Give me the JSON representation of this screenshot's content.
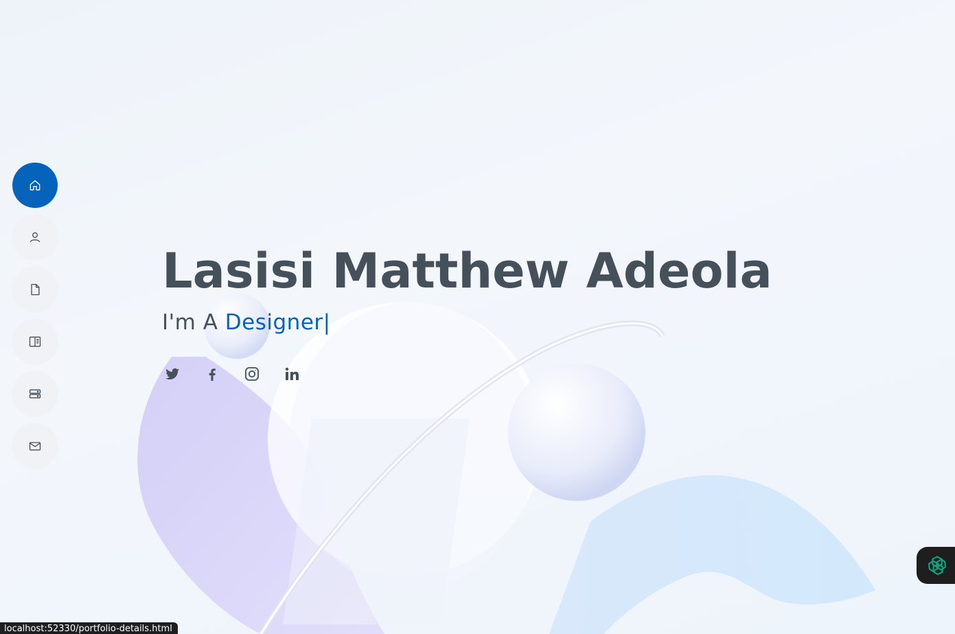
{
  "hero": {
    "name": "Lasisi Matthew Adeola",
    "subtitle_prefix": "I'm A",
    "subtitle_typed": "Designer|"
  },
  "nav": {
    "items": [
      {
        "icon": "home-icon",
        "active": true
      },
      {
        "icon": "person-icon",
        "active": false
      },
      {
        "icon": "file-icon",
        "active": false
      },
      {
        "icon": "book-half-icon",
        "active": false
      },
      {
        "icon": "server-icon",
        "active": false
      },
      {
        "icon": "envelope-icon",
        "active": false
      }
    ]
  },
  "social": [
    {
      "icon": "twitter-icon"
    },
    {
      "icon": "facebook-icon"
    },
    {
      "icon": "instagram-icon"
    },
    {
      "icon": "linkedin-icon"
    }
  ],
  "status_bar": {
    "url": "localhost:52330/portfolio-details.html"
  },
  "colors": {
    "accent": "#0563bb",
    "text": "#45505b",
    "nav_bg": "#f0f2f5"
  }
}
